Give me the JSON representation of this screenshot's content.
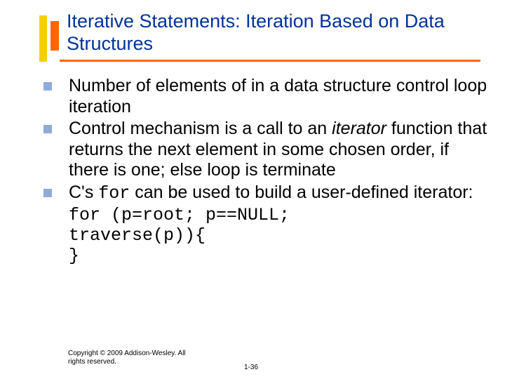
{
  "title": "Iterative Statements: Iteration Based on Data Structures",
  "bullets": [
    {
      "text": "Number of elements of in a data structure control loop iteration"
    },
    {
      "pre": "Control mechanism is a call to an ",
      "em": "iterator",
      "post": " function that returns the next element in some chosen order, if there is one; else loop is terminate"
    },
    {
      "pre2": "C's ",
      "code": "for",
      "post2": " can be used to build a user-defined iterator:"
    }
  ],
  "code_lines": {
    "l1": "for (p=root; p==NULL;",
    "l2": "traverse(p)){",
    "l3": "}"
  },
  "copyright": "Copyright © 2009 Addison-Wesley. All rights reserved.",
  "pagenum": "1-36"
}
